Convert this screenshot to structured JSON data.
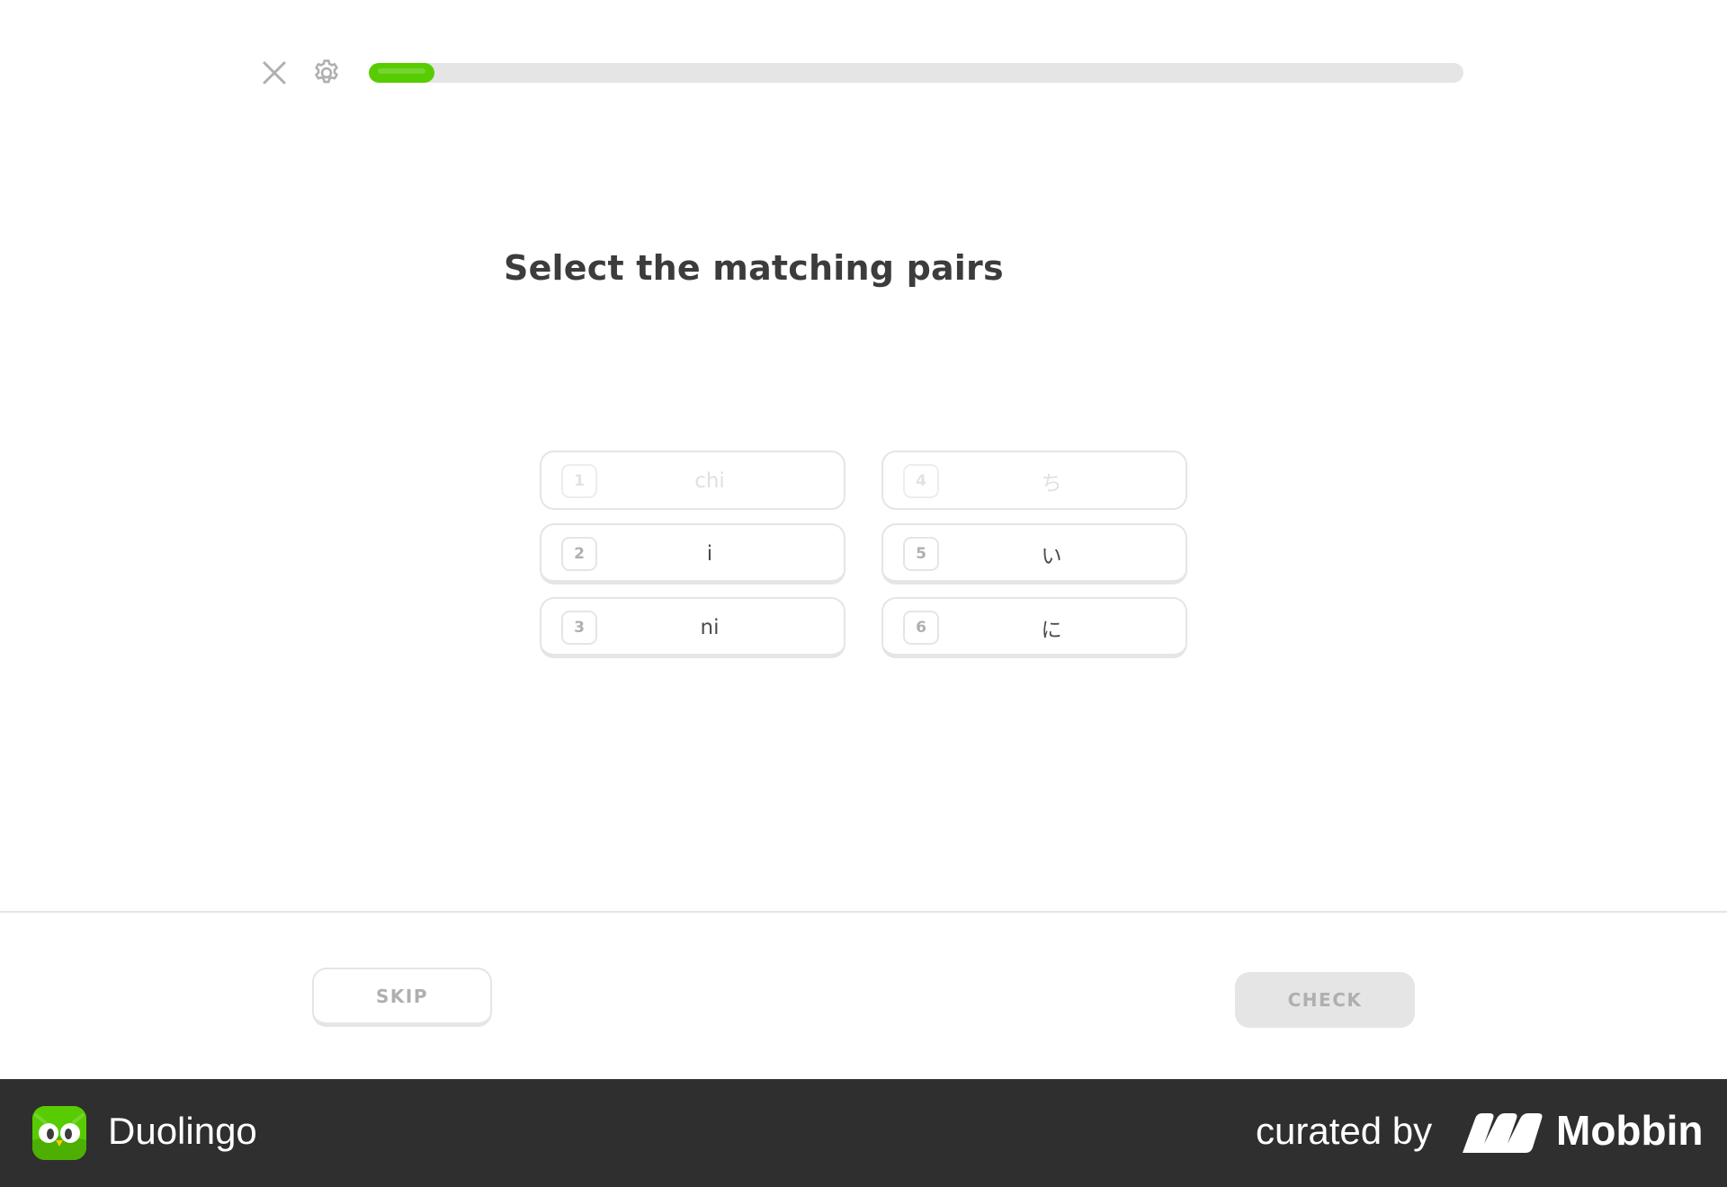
{
  "lesson": {
    "progress_fraction": 0.06,
    "title": "Select the matching pairs"
  },
  "tiles": {
    "left": [
      {
        "number": "1",
        "text": "chi",
        "state": "matched"
      },
      {
        "number": "2",
        "text": "i",
        "state": "default"
      },
      {
        "number": "3",
        "text": "ni",
        "state": "default"
      }
    ],
    "right": [
      {
        "number": "4",
        "text": "ち",
        "state": "matched"
      },
      {
        "number": "5",
        "text": "い",
        "state": "default"
      },
      {
        "number": "6",
        "text": "に",
        "state": "default"
      }
    ]
  },
  "footer": {
    "skip_label": "SKIP",
    "check_label": "CHECK"
  },
  "brand": {
    "app_name": "Duolingo",
    "curated_by": "curated by",
    "curator": "Mobbin"
  },
  "colors": {
    "accent_green": "#58cc02",
    "border_gray": "#e5e5e5",
    "disabled_text": "#afafaf",
    "brand_bar": "#2f2f2f"
  },
  "icons": {
    "close": "close-icon",
    "settings": "gear-icon",
    "app": "duolingo-owl-icon",
    "curator": "mobbin-logo-icon"
  }
}
